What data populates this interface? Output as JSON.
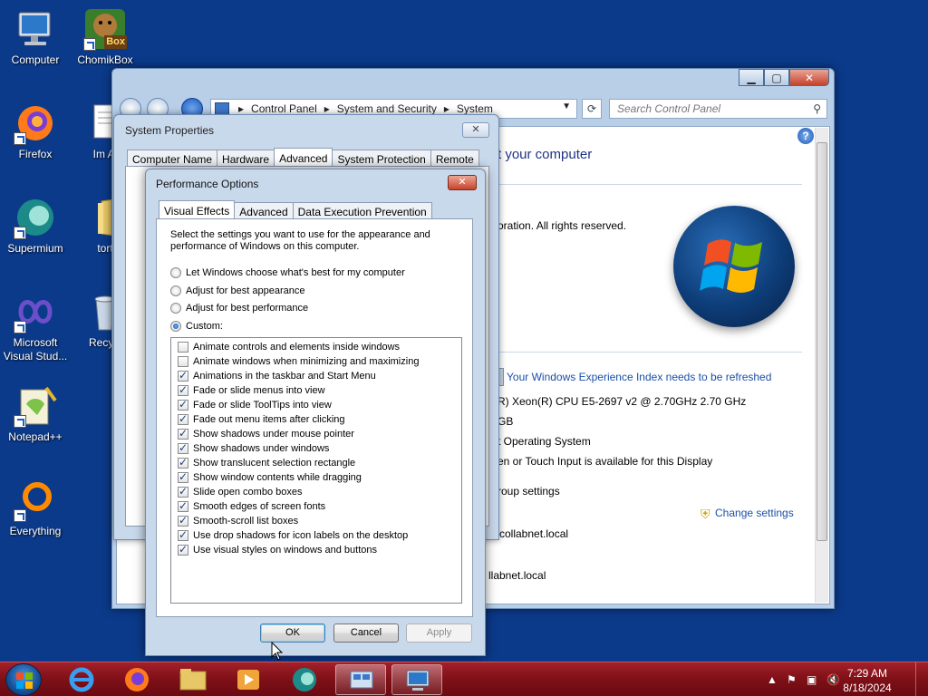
{
  "desktop": {
    "icons": [
      {
        "label": "Computer"
      },
      {
        "label": "ChomikBox"
      },
      {
        "label": "Firefox"
      },
      {
        "label": "Im Al"
      },
      {
        "label": "Supermium"
      },
      {
        "label": "tort"
      },
      {
        "label": "Microsoft Visual Stud..."
      },
      {
        "label": "Recycl"
      },
      {
        "label": "Notepad++"
      },
      {
        "label": "Everything"
      }
    ],
    "chomikbox_badge": "Box"
  },
  "system_window": {
    "breadcrumb": [
      "Control Panel",
      "System and Security",
      "System"
    ],
    "search_placeholder": "Search Control Panel",
    "heading_partial": "t your computer",
    "copyright_partial": "oration.  All rights reserved.",
    "wei_link": "Your Windows Experience Index needs to be refreshed",
    "processor_partial": "R) Xeon(R) CPU E5-2697 v2 @ 2.70GHz   2.70 GHz",
    "memory_partial": "GB",
    "system_type_partial": "t Operating System",
    "pen_partial": "en or Touch Input is available for this Display",
    "workgroup_partial": "roup settings",
    "change_settings": "Change settings",
    "domain1_partial": "collabnet.local",
    "domain2_partial": "llabnet.local"
  },
  "system_properties": {
    "title": "System Properties",
    "close_glyph": "✕",
    "tabs": [
      "Computer Name",
      "Hardware",
      "Advanced",
      "System Protection",
      "Remote"
    ],
    "active_tab": "Advanced"
  },
  "performance_options": {
    "title": "Performance Options",
    "close_glyph": "✕",
    "tabs": [
      "Visual Effects",
      "Advanced",
      "Data Execution Prevention"
    ],
    "active_tab": "Visual Effects",
    "description": "Select the settings you want to use for the appearance and performance of Windows on this computer.",
    "radios": [
      {
        "label": "Let Windows choose what's best for my computer",
        "checked": false
      },
      {
        "label": "Adjust for best appearance",
        "checked": false
      },
      {
        "label": "Adjust for best performance",
        "checked": false
      },
      {
        "label": "Custom:",
        "checked": true
      }
    ],
    "effects": [
      {
        "label": "Animate controls and elements inside windows",
        "checked": false
      },
      {
        "label": "Animate windows when minimizing and maximizing",
        "checked": false
      },
      {
        "label": "Animations in the taskbar and Start Menu",
        "checked": true
      },
      {
        "label": "Fade or slide menus into view",
        "checked": true
      },
      {
        "label": "Fade or slide ToolTips into view",
        "checked": true
      },
      {
        "label": "Fade out menu items after clicking",
        "checked": true
      },
      {
        "label": "Show shadows under mouse pointer",
        "checked": true
      },
      {
        "label": "Show shadows under windows",
        "checked": true
      },
      {
        "label": "Show translucent selection rectangle",
        "checked": true
      },
      {
        "label": "Show window contents while dragging",
        "checked": true
      },
      {
        "label": "Slide open combo boxes",
        "checked": true
      },
      {
        "label": "Smooth edges of screen fonts",
        "checked": true
      },
      {
        "label": "Smooth-scroll list boxes",
        "checked": true
      },
      {
        "label": "Use drop shadows for icon labels on the desktop",
        "checked": true
      },
      {
        "label": "Use visual styles on windows and buttons",
        "checked": true
      }
    ],
    "buttons": {
      "ok": "OK",
      "cancel": "Cancel",
      "apply": "Apply"
    }
  },
  "taskbar": {
    "time": "7:29 AM",
    "date": "8/18/2024",
    "apps": [
      "internet-explorer",
      "firefox",
      "file-explorer",
      "media-player",
      "supermium",
      "performance-options",
      "system"
    ]
  },
  "colors": {
    "desktop_bg": "#0b3a8a",
    "taskbar": "#7e1017",
    "link": "#1a4fa8"
  }
}
